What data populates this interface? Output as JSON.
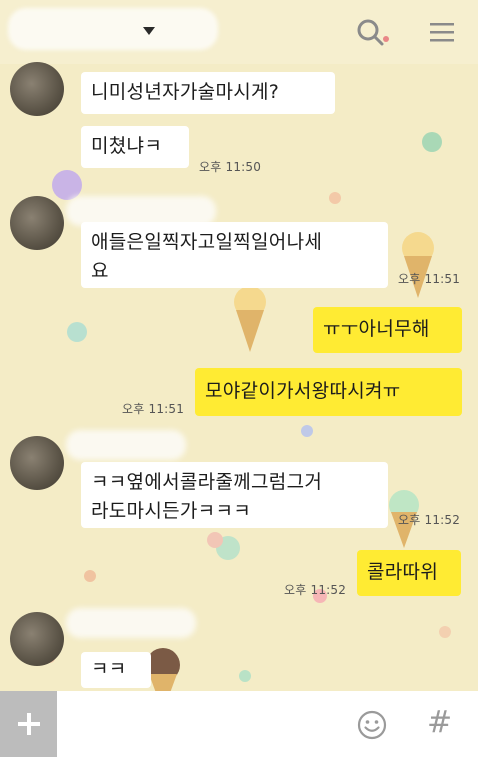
{
  "header": {
    "search_icon": "search-icon",
    "menu_icon": "hamburger-menu-icon"
  },
  "messages": [
    {
      "side": "other",
      "text": "니미성년자가술마시게?"
    },
    {
      "side": "other",
      "text": "미쳤냐ㅋ",
      "time": "오후 11:50"
    },
    {
      "side": "other",
      "text_line1": "애들은일찍자고일찍일어나세",
      "text_line2": "요",
      "time": "오후 11:51"
    },
    {
      "side": "me",
      "text": "ㅠㅜ아너무해"
    },
    {
      "side": "me",
      "text": "모야같이가서왕따시켜ㅠ",
      "time": "오후 11:51"
    },
    {
      "side": "other",
      "text_line1": "ㅋㅋ옆에서콜라줄께그럼그거",
      "text_line2": "라도마시든가ㅋㅋㅋ",
      "time": "오후 11:52"
    },
    {
      "side": "me",
      "text": "콜라따위",
      "time": "오후 11:52"
    },
    {
      "side": "other",
      "text": "ㅋㅋ"
    }
  ],
  "input_bar": {
    "plus_label": "+",
    "emoji_icon": "emoji-smile-icon",
    "hash_label": "#"
  },
  "colors": {
    "background": "#f4ecc6",
    "my_bubble": "#ffeb33",
    "other_bubble": "#ffffff"
  }
}
